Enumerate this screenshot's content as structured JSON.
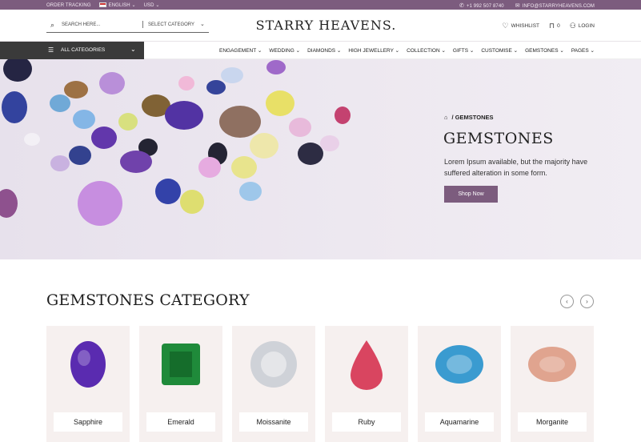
{
  "topbar": {
    "order_tracking": "ORDER TRACKING",
    "language": "ENGLISH",
    "currency": "USD",
    "phone": "+1 992 507 8740",
    "email": "INFO@STARRYHEAVENS.COM"
  },
  "header": {
    "search_placeholder": "SEARCH HERE...",
    "select_category": "SELECT CATEGORY",
    "logo": "STARRY HEAVENS.",
    "wishlist": "WHISHLIST",
    "cart_count": "0",
    "login": "LOGIN"
  },
  "nav": {
    "all_categories": "ALL CATEGORIES",
    "items": [
      "ENGAGEMENT",
      "WEDDING",
      "DIAMONDS",
      "HIGH JEWELLERY",
      "COLLECTION",
      "GIFTS",
      "CUSTOMISE",
      "GEMSTONES",
      "PAGES"
    ]
  },
  "hero": {
    "breadcrumb_sep": "/",
    "breadcrumb_current": "GEMSTONES",
    "title": "GEMSTONES",
    "description": "Lorem Ipsum available, but the majority have suffered alteration in some form.",
    "cta": "Shop Now"
  },
  "category": {
    "title": "GEMSTONES CATEGORY",
    "items": [
      {
        "name": "Sapphire",
        "color": "#5a2bb0"
      },
      {
        "name": "Emerald",
        "color": "#1f8a3a"
      },
      {
        "name": "Moissanite",
        "color": "#cfd2d8"
      },
      {
        "name": "Ruby",
        "color": "#d94560"
      },
      {
        "name": "Aquamarine",
        "color": "#3a9bd0"
      },
      {
        "name": "Morganite",
        "color": "#e0a48f"
      }
    ]
  },
  "colors": {
    "brand": "#7c5c7e",
    "nav_dark": "#3a3a3a",
    "card_bg": "#f6f0ef"
  }
}
